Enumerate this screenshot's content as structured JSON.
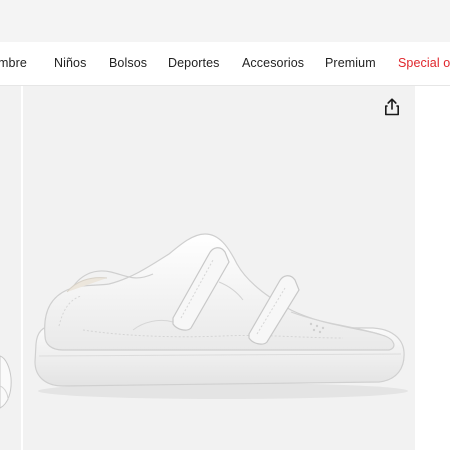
{
  "top_bar": {},
  "nav": {
    "items": [
      {
        "label": "mbre"
      },
      {
        "label": "Niños"
      },
      {
        "label": "Bolsos"
      },
      {
        "label": "Deportes"
      },
      {
        "label": "Accesorios"
      },
      {
        "label": "Premium"
      },
      {
        "label": "Special o"
      }
    ],
    "special_color": "#e0252b"
  },
  "gallery": {
    "share_icon": "share-icon",
    "image_subject": "white velcro sneaker"
  }
}
